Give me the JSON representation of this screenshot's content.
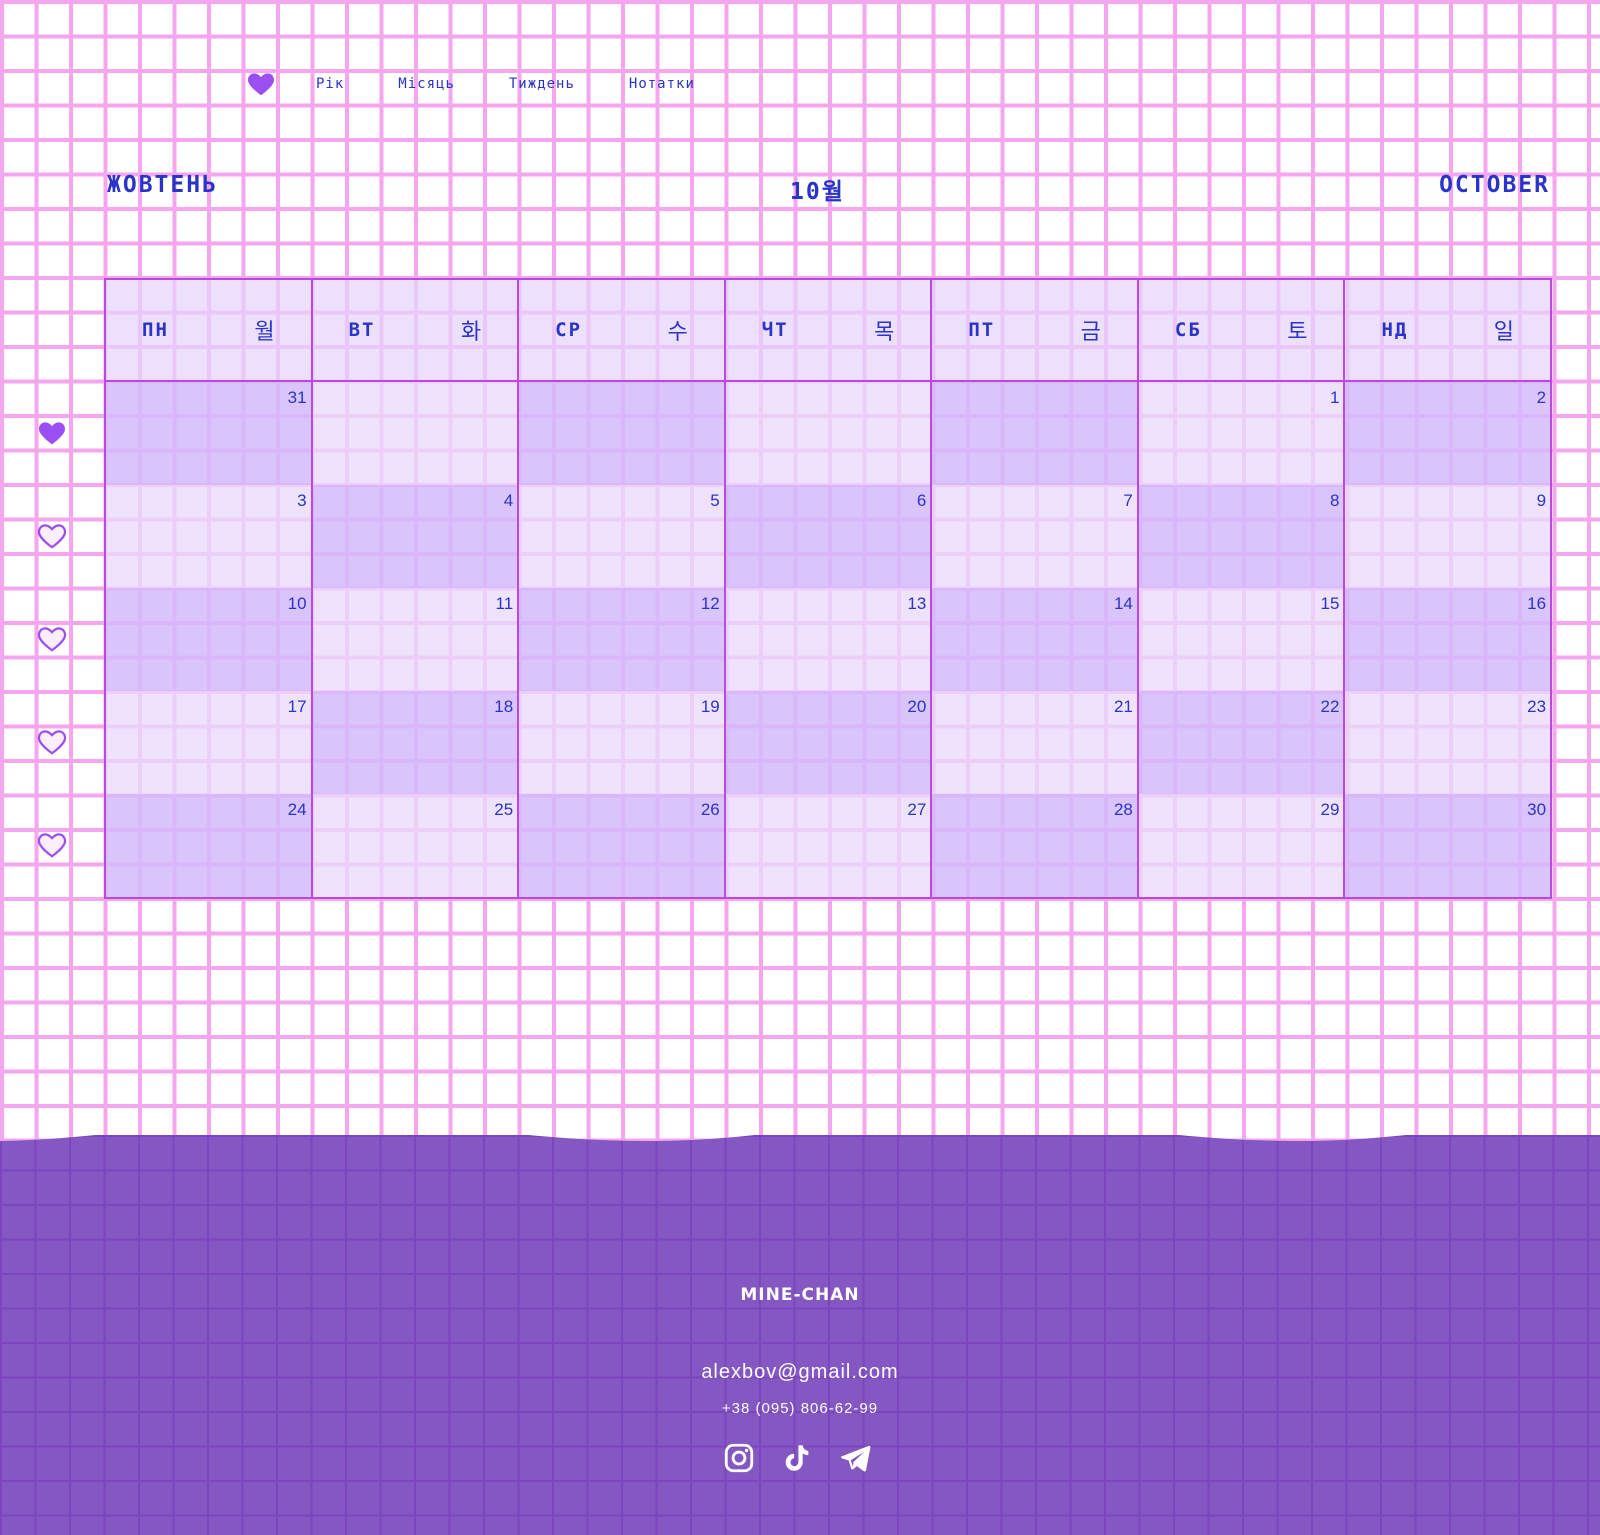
{
  "nav": {
    "items": [
      "Рік",
      "Місяць",
      "Тиждень",
      "Нотатки"
    ]
  },
  "month": {
    "uk": "ЖОВТЕНЬ",
    "ko": "10월",
    "en": "OCTOBER"
  },
  "weekdays": [
    {
      "uk": "ПН",
      "ko": "월"
    },
    {
      "uk": "ВТ",
      "ko": "화"
    },
    {
      "uk": "СР",
      "ko": "수"
    },
    {
      "uk": "ЧТ",
      "ko": "목"
    },
    {
      "uk": "ПТ",
      "ko": "금"
    },
    {
      "uk": "СБ",
      "ko": "토"
    },
    {
      "uk": "НД",
      "ko": "일"
    }
  ],
  "weeks": [
    [
      "31",
      "",
      "",
      "",
      "",
      "1",
      "2"
    ],
    [
      "3",
      "4",
      "5",
      "6",
      "7",
      "8",
      "9"
    ],
    [
      "10",
      "11",
      "12",
      "13",
      "14",
      "15",
      "16"
    ],
    [
      "17",
      "18",
      "19",
      "20",
      "21",
      "22",
      "23"
    ],
    [
      "24",
      "25",
      "26",
      "27",
      "28",
      "29",
      "30"
    ]
  ],
  "week_markers": [
    "filled",
    "outline",
    "outline",
    "outline",
    "outline"
  ],
  "footer": {
    "brand": "MINE-CHAN",
    "email": "alexbov@gmail.com",
    "phone": "+38 (095) 806-62-99",
    "socials": [
      "instagram-icon",
      "tiktok-icon",
      "telegram-icon"
    ]
  },
  "colors": {
    "accent": "#9b4ef2",
    "text": "#2a34c9",
    "grid": "#f5a6ee",
    "footer": "#8557c2"
  }
}
